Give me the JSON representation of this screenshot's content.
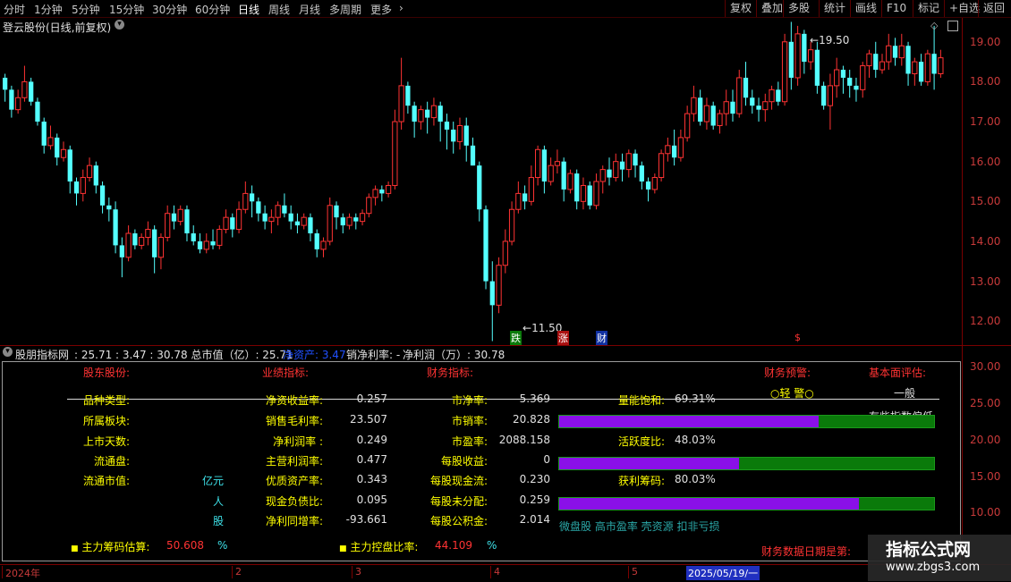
{
  "toolbar": {
    "left": [
      "分时",
      "1分钟",
      "5分钟",
      "15分钟",
      "30分钟",
      "60分钟",
      "日线",
      "周线",
      "月线",
      "多周期",
      "更多"
    ],
    "active": "日线",
    "right": [
      "复权",
      "叠加",
      "多股",
      "统计",
      "画线",
      "F10",
      "标记",
      "+自选",
      "返回"
    ]
  },
  "chart": {
    "title": "登云股份(日线,前复权)",
    "high_label": "19.50",
    "low_label": "11.50",
    "markers": [
      "跌",
      "涨",
      "财",
      "$"
    ],
    "colors": {
      "up": "#ff3333",
      "down": "#54ffff",
      "bg": "#000000"
    },
    "candles": [
      [
        18.1,
        17.8,
        18.2,
        17.5
      ],
      [
        17.8,
        17.3,
        17.9,
        17.1
      ],
      [
        17.3,
        17.6,
        17.8,
        17.2
      ],
      [
        17.6,
        18.0,
        18.4,
        17.5
      ],
      [
        18.0,
        17.5,
        18.1,
        17.4
      ],
      [
        17.5,
        17.0,
        17.6,
        16.9
      ],
      [
        17.0,
        16.4,
        17.1,
        16.2
      ],
      [
        16.4,
        16.6,
        16.9,
        16.3
      ],
      [
        16.6,
        16.1,
        16.7,
        15.9
      ],
      [
        16.1,
        16.3,
        16.5,
        16.0
      ],
      [
        16.3,
        15.5,
        16.4,
        15.2
      ],
      [
        15.5,
        15.2,
        15.6,
        14.9
      ],
      [
        15.2,
        15.6,
        15.8,
        15.0
      ],
      [
        15.6,
        15.9,
        16.1,
        15.5
      ],
      [
        15.9,
        15.4,
        16.0,
        15.2
      ],
      [
        15.4,
        14.9,
        15.5,
        14.7
      ],
      [
        14.9,
        14.8,
        15.1,
        14.5
      ],
      [
        14.8,
        13.9,
        15.0,
        13.7
      ],
      [
        13.9,
        13.6,
        14.1,
        13.1
      ],
      [
        13.6,
        14.2,
        14.4,
        13.5
      ],
      [
        14.2,
        13.9,
        14.3,
        13.8
      ],
      [
        13.9,
        14.1,
        14.2,
        13.8
      ],
      [
        14.1,
        14.3,
        14.5,
        13.9
      ],
      [
        14.3,
        13.6,
        14.4,
        13.2
      ],
      [
        13.6,
        14.1,
        14.2,
        13.3
      ],
      [
        14.1,
        14.7,
        14.9,
        14.0
      ],
      [
        14.7,
        14.5,
        14.9,
        14.3
      ],
      [
        14.5,
        14.8,
        14.9,
        14.4
      ],
      [
        14.8,
        14.2,
        14.9,
        14.0
      ],
      [
        14.2,
        14.0,
        14.4,
        13.9
      ],
      [
        14.0,
        13.8,
        14.2,
        13.7
      ],
      [
        13.8,
        14.0,
        14.2,
        13.7
      ],
      [
        14.0,
        13.9,
        14.3,
        13.8
      ],
      [
        13.9,
        14.3,
        14.4,
        13.8
      ],
      [
        14.3,
        14.6,
        14.8,
        14.2
      ],
      [
        14.6,
        14.3,
        14.7,
        14.1
      ],
      [
        14.3,
        14.8,
        15.0,
        14.2
      ],
      [
        14.8,
        15.2,
        15.5,
        14.7
      ],
      [
        15.2,
        15.0,
        15.4,
        14.6
      ],
      [
        15.0,
        14.7,
        15.1,
        14.5
      ],
      [
        14.7,
        14.5,
        14.9,
        14.3
      ],
      [
        14.5,
        14.6,
        14.8,
        14.2
      ],
      [
        14.6,
        14.9,
        15.0,
        14.4
      ],
      [
        14.9,
        14.7,
        15.2,
        14.6
      ],
      [
        14.7,
        14.5,
        14.9,
        14.3
      ],
      [
        14.5,
        14.4,
        14.7,
        14.2
      ],
      [
        14.4,
        14.6,
        14.7,
        14.3
      ],
      [
        14.6,
        14.2,
        14.7,
        14.0
      ],
      [
        14.2,
        13.8,
        14.3,
        13.6
      ],
      [
        13.8,
        14.0,
        14.1,
        13.6
      ],
      [
        14.0,
        14.9,
        15.1,
        13.9
      ],
      [
        14.9,
        14.6,
        15.0,
        14.3
      ],
      [
        14.6,
        14.4,
        14.7,
        14.2
      ],
      [
        14.4,
        14.6,
        14.7,
        14.3
      ],
      [
        14.6,
        14.5,
        14.7,
        14.3
      ],
      [
        14.5,
        14.7,
        14.8,
        14.4
      ],
      [
        14.7,
        15.1,
        15.2,
        14.6
      ],
      [
        15.1,
        15.3,
        15.4,
        14.9
      ],
      [
        15.3,
        15.2,
        15.4,
        15.0
      ],
      [
        15.2,
        15.4,
        15.5,
        15.1
      ],
      [
        15.4,
        17.0,
        17.3,
        15.3
      ],
      [
        17.0,
        17.9,
        18.6,
        16.8
      ],
      [
        17.9,
        17.4,
        18.0,
        17.2
      ],
      [
        17.4,
        17.0,
        17.5,
        16.6
      ],
      [
        17.0,
        17.3,
        17.4,
        16.8
      ],
      [
        17.3,
        17.1,
        17.5,
        16.7
      ],
      [
        17.1,
        17.4,
        17.6,
        16.9
      ],
      [
        17.4,
        17.0,
        17.5,
        16.5
      ],
      [
        17.0,
        16.8,
        17.2,
        16.3
      ],
      [
        16.8,
        16.5,
        17.0,
        16.2
      ],
      [
        16.5,
        16.9,
        17.1,
        16.3
      ],
      [
        16.9,
        16.4,
        17.1,
        16.0
      ],
      [
        16.4,
        15.9,
        16.6,
        15.9
      ],
      [
        15.9,
        14.8,
        16.0,
        14.5
      ],
      [
        14.8,
        13.0,
        14.9,
        12.8
      ],
      [
        13.0,
        12.4,
        13.5,
        11.5
      ],
      [
        12.4,
        13.4,
        13.6,
        12.2
      ],
      [
        13.4,
        14.0,
        14.3,
        13.2
      ],
      [
        14.0,
        14.8,
        15.0,
        13.9
      ],
      [
        14.8,
        15.2,
        15.5,
        14.7
      ],
      [
        15.2,
        15.0,
        15.4,
        14.8
      ],
      [
        15.0,
        15.6,
        15.9,
        14.9
      ],
      [
        15.6,
        16.3,
        16.4,
        15.4
      ],
      [
        16.3,
        15.5,
        16.4,
        15.2
      ],
      [
        15.5,
        15.9,
        16.1,
        15.4
      ],
      [
        15.9,
        16.0,
        16.3,
        15.7
      ],
      [
        16.0,
        15.3,
        16.1,
        15.0
      ],
      [
        15.3,
        15.7,
        15.8,
        15.2
      ],
      [
        15.7,
        15.0,
        15.8,
        14.8
      ],
      [
        15.0,
        15.4,
        15.6,
        14.8
      ],
      [
        15.4,
        14.9,
        15.5,
        14.8
      ],
      [
        14.9,
        15.5,
        15.7,
        14.8
      ],
      [
        15.5,
        15.8,
        15.9,
        15.2
      ],
      [
        15.8,
        15.6,
        16.1,
        15.4
      ],
      [
        15.6,
        16.0,
        16.2,
        15.5
      ],
      [
        16.0,
        15.8,
        16.2,
        15.5
      ],
      [
        15.8,
        16.2,
        16.3,
        15.6
      ],
      [
        16.2,
        15.9,
        16.3,
        15.6
      ],
      [
        15.9,
        15.5,
        16.0,
        15.3
      ],
      [
        15.5,
        15.3,
        15.6,
        15.0
      ],
      [
        15.3,
        15.6,
        15.7,
        15.2
      ],
      [
        15.6,
        16.2,
        16.3,
        15.5
      ],
      [
        16.2,
        16.4,
        16.6,
        16.0
      ],
      [
        16.4,
        16.1,
        16.8,
        15.9
      ],
      [
        16.1,
        16.6,
        16.8,
        16.0
      ],
      [
        16.6,
        17.2,
        17.4,
        16.5
      ],
      [
        17.2,
        17.6,
        17.9,
        17.0
      ],
      [
        17.6,
        17.0,
        17.8,
        16.9
      ],
      [
        17.0,
        17.4,
        17.6,
        16.8
      ],
      [
        17.4,
        16.9,
        17.5,
        16.8
      ],
      [
        16.9,
        17.2,
        17.3,
        16.7
      ],
      [
        17.2,
        17.5,
        17.8,
        16.9
      ],
      [
        17.5,
        17.2,
        17.8,
        17.0
      ],
      [
        17.2,
        18.1,
        18.3,
        17.1
      ],
      [
        18.1,
        17.6,
        18.5,
        17.4
      ],
      [
        17.6,
        17.4,
        17.8,
        17.2
      ],
      [
        17.4,
        17.3,
        17.6,
        17.0
      ],
      [
        17.3,
        17.5,
        17.7,
        17.0
      ],
      [
        17.5,
        17.8,
        17.9,
        17.3
      ],
      [
        17.8,
        17.5,
        18.0,
        17.4
      ],
      [
        17.5,
        19.0,
        19.2,
        17.4
      ],
      [
        19.0,
        18.1,
        19.5,
        17.8
      ],
      [
        18.1,
        19.2,
        19.4,
        17.9
      ],
      [
        19.2,
        18.5,
        19.3,
        18.2
      ],
      [
        18.5,
        18.8,
        19.0,
        18.3
      ],
      [
        18.8,
        17.9,
        19.0,
        17.7
      ],
      [
        17.9,
        17.4,
        18.0,
        17.3
      ],
      [
        17.4,
        17.9,
        18.2,
        16.8
      ],
      [
        17.9,
        18.3,
        18.6,
        17.6
      ],
      [
        18.3,
        18.1,
        18.4,
        17.7
      ],
      [
        18.1,
        17.9,
        18.3,
        17.6
      ],
      [
        17.9,
        17.8,
        18.1,
        17.5
      ],
      [
        17.8,
        18.4,
        18.5,
        17.6
      ],
      [
        18.4,
        18.7,
        18.8,
        18.1
      ],
      [
        18.7,
        18.3,
        19.0,
        18.1
      ],
      [
        18.3,
        18.5,
        18.7,
        18.2
      ],
      [
        18.5,
        18.9,
        19.2,
        18.3
      ],
      [
        18.9,
        18.6,
        19.1,
        18.4
      ],
      [
        18.6,
        18.9,
        19.2,
        18.4
      ],
      [
        18.9,
        18.2,
        19.0,
        17.9
      ],
      [
        18.2,
        18.5,
        18.6,
        17.9
      ],
      [
        18.5,
        18.0,
        18.7,
        17.9
      ],
      [
        18.0,
        18.7,
        18.8,
        17.9
      ],
      [
        18.7,
        18.2,
        19.4,
        17.8
      ],
      [
        18.2,
        18.6,
        18.8,
        18.1
      ]
    ]
  },
  "info_bar": {
    "title": "股朋指标网",
    "text1": ": 25.71 : 3.47 : 30.78 总市值（亿）: 25.71",
    "text2": "净资产: 3.47",
    "text3": "销净利率: -",
    "text4": "净利润（万）: 30.78"
  },
  "panel": {
    "headers": {
      "stock": "股东股份:",
      "performance": "业绩指标:",
      "finance": "财务指标:",
      "warning": "财务预警:",
      "evaluation": "基本面评估:"
    },
    "warning_value": "○轻 警○",
    "evaluation_value": "一般",
    "evaluation_note": "有些指数偏低",
    "left_labels": [
      "品种类型:",
      "所属板块:",
      "上市天数:",
      "流通盘:",
      "流通市值:"
    ],
    "units": [
      "亿元",
      "人",
      "股"
    ],
    "perf_labels": [
      "净资收益率:",
      "销售毛利率:",
      "净利润率 :",
      "主营利润率:",
      "优质资产率:",
      "现金负债比:",
      "净利同增率:"
    ],
    "perf_values": [
      "0.257",
      "23.507",
      "0.249",
      "0.477",
      "0.343",
      "0.095",
      "-93.661"
    ],
    "fin_labels": [
      "市净率:",
      "市销率:",
      "市盈率:",
      "每股收益:",
      "每股现金流:",
      "每股未分配:",
      "每股公积金:"
    ],
    "fin_values": [
      "5.369",
      "20.828",
      "2088.158",
      "0",
      "0.230",
      "0.259",
      "2.014"
    ],
    "meters": [
      {
        "label": "量能饱和:",
        "value": "69.31%",
        "fraction": 0.6931
      },
      {
        "label": "活跃度比:",
        "value": "48.03%",
        "fraction": 0.4803
      },
      {
        "label": "获利筹码:",
        "value": "80.03%",
        "fraction": 0.8003
      }
    ],
    "tags": "微盘股 高市盈率 壳资源 扣非亏损",
    "main_chip_label": "主力筹码估算:",
    "main_chip_value": "50.608",
    "main_chip_unit": "%",
    "main_control_label": "主力控盘比率:",
    "main_control_value": "44.109",
    "main_control_unit": "%",
    "finance_date_label": "财务数据日期是第:"
  },
  "scale": {
    "price_ticks": [
      "19.00",
      "18.00",
      "17.00",
      "16.00",
      "15.00",
      "14.00",
      "13.00",
      "12.00"
    ],
    "panel_ticks": [
      "30.00",
      "25.00",
      "20.00",
      "15.00",
      "10.00"
    ]
  },
  "time_axis": {
    "labels": [
      "2024年",
      "2",
      "3",
      "4",
      "5"
    ],
    "highlight": "2025/05/19/一"
  },
  "watermark": {
    "line1": "指标公式网",
    "line2": "www.zbgs3.com"
  }
}
